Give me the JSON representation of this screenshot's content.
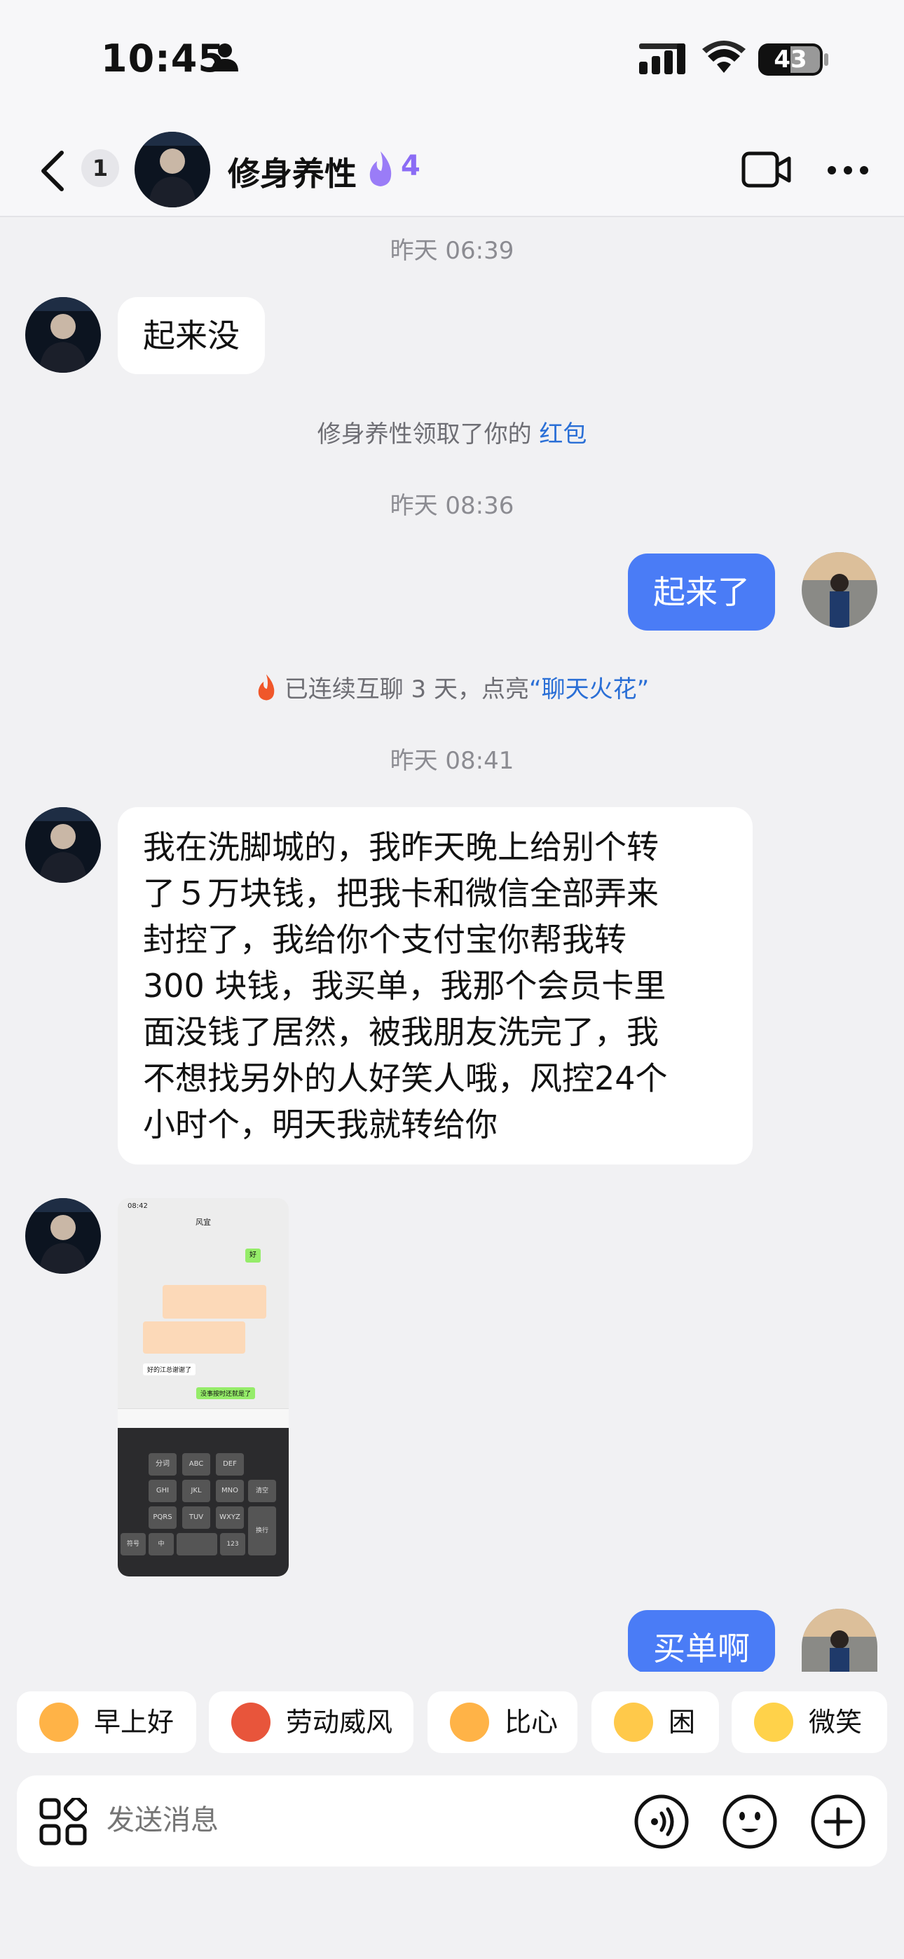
{
  "status_bar": {
    "time": "10:45",
    "battery": "43"
  },
  "header": {
    "back_count": "1",
    "contact_name": "修身养性",
    "spark_count": "4"
  },
  "messages": {
    "ts1": "昨天 06:39",
    "msg1": "起来没",
    "sys_redpacket_prefix": "修身养性领取了你的",
    "sys_redpacket_link": "红包",
    "ts2": "昨天 08:36",
    "msg2": "起来了",
    "sys_spark_prefix": "已连续互聊 3 天，点亮",
    "sys_spark_link": "“聊天火花”",
    "ts3": "昨天 08:41",
    "msg3_lines": [
      "我在洗脚城的，我昨天晚上给别个转",
      "了５万块钱，把我卡和微信全部弄来",
      "封控了，我给你个支付宝你帮我转",
      "300 块钱，我买单，我那个会员卡里",
      "面没钱了居然，被我朋友洗完了，我",
      "不想找另外的人好笑人哦，风控24个",
      "小时个，明天我就转给你"
    ],
    "msg4": "买单啊"
  },
  "screenshot": {
    "time": "08:42",
    "title": "风宜",
    "line1": "好的江总谢谢了",
    "line2": "没事按时还就是了",
    "ok": "好",
    "keys": [
      "分词",
      "ABC",
      "DEF",
      "GHI",
      "JKL",
      "MNO",
      "PQRS",
      "TUV",
      "WXYZ",
      "符号",
      "中",
      "123",
      "换行",
      "清空"
    ]
  },
  "quick_replies": [
    {
      "label": "早上好",
      "color": "#ffb347"
    },
    {
      "label": "劳动威风",
      "color": "#e8553b"
    },
    {
      "label": "比心",
      "color": "#ffb347"
    },
    {
      "label": "困",
      "color": "#ffc94a"
    },
    {
      "label": "微笑",
      "color": "#ffd24a"
    }
  ],
  "input": {
    "placeholder": "发送消息"
  },
  "colors": {
    "accent_blue": "#4a7cf6",
    "link_blue": "#2a6fd6",
    "spark_purple": "#8b6cf5"
  }
}
